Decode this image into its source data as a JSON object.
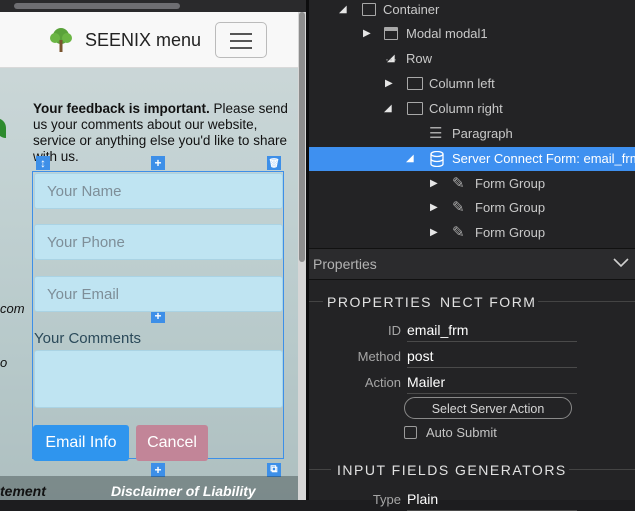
{
  "canvas": {
    "brand": "SEENIX menu",
    "feedback_bold": "Your feedback is important.",
    "feedback_rest": " Please send us your comments about our website, service or anything else you'd like to share with us.",
    "side_com": "com",
    "side_o": "o",
    "fields": {
      "name_placeholder": "Your Name",
      "phone_placeholder": "Your Phone",
      "email_placeholder": "Your Email",
      "comments_label": "Your Comments",
      "comments_value": ""
    },
    "buttons": {
      "email": "Email Info",
      "cancel": "Cancel"
    },
    "footer_left": "tement",
    "footer_right": "Disclaimer of Liability",
    "handles": {
      "move": "↕",
      "add": "+",
      "delete": "🗑",
      "copy": "⧉"
    }
  },
  "tree": [
    {
      "label": "Container",
      "icon": "container-icon",
      "expanded": true
    },
    {
      "label": "Modal modal1",
      "icon": "modal-icon",
      "expanded": false
    },
    {
      "label": "Row",
      "icon": "row-icon",
      "expanded": true
    },
    {
      "label": "Column left",
      "icon": "column-icon",
      "expanded": false
    },
    {
      "label": "Column right",
      "icon": "column-icon",
      "expanded": true
    },
    {
      "label": "Paragraph",
      "icon": "paragraph-icon",
      "expanded": null
    },
    {
      "label": "Server Connect Form: email_frm",
      "icon": "database-icon",
      "expanded": true,
      "selected": true
    },
    {
      "label": "Form Group",
      "icon": "pencil-icon",
      "expanded": false
    },
    {
      "label": "Form Group",
      "icon": "pencil-icon",
      "expanded": false
    },
    {
      "label": "Form Group",
      "icon": "pencil-icon",
      "expanded": false
    }
  ],
  "properties": {
    "header": "Properties",
    "section_title": "PROPERTIES",
    "section_title_2": "NECT FORM",
    "id_label": "ID",
    "id_value": "email_frm",
    "method_label": "Method",
    "method_value": "post",
    "action_label": "Action",
    "action_value": "Mailer",
    "select_action_button": "Select Server Action",
    "auto_submit_label": "Auto Submit",
    "auto_submit_checked": false,
    "generators_title": "INPUT FIELDS GENERATORS",
    "type_label": "Type",
    "type_value": "Plain"
  },
  "colors": {
    "selection_blue": "#3e90f0",
    "email_button": "#2f95ee",
    "cancel_button": "#c28598",
    "panel_bg": "#232325"
  }
}
